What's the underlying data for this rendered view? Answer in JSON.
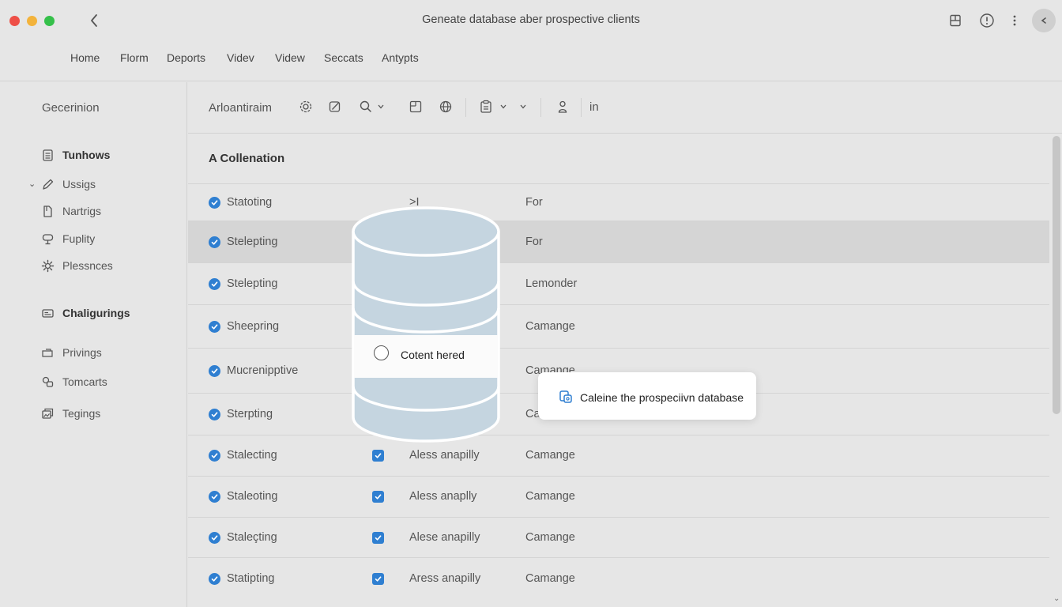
{
  "window": {
    "title": "Geneate database aber prospective clients"
  },
  "menu": [
    "Home",
    "Florm",
    "Deports",
    "Videv",
    "Videw",
    "Seccats",
    "Antypts"
  ],
  "sidebar": {
    "heading": "Gecerinion",
    "items": [
      {
        "label": "Tunhows",
        "icon": "document-icon",
        "bold": true
      },
      {
        "label": "Ussigs",
        "icon": "pencil-icon",
        "expand": true
      },
      {
        "label": "Nartrigs",
        "icon": "file-icon"
      },
      {
        "label": "Fuplity",
        "icon": "stamp-icon"
      },
      {
        "label": "Plessnces",
        "icon": "gear-icon"
      },
      {
        "label": "Chaligurings",
        "icon": "card-icon",
        "bold": true
      },
      {
        "label": "Privings",
        "icon": "tag-icon"
      },
      {
        "label": "Tomcarts",
        "icon": "link-icon"
      },
      {
        "label": "Tegings",
        "icon": "image-icon"
      }
    ]
  },
  "toolbar": {
    "title": "Arloantiraim",
    "trailing_text": "in"
  },
  "section": {
    "title": "A Collenation"
  },
  "rows": [
    {
      "col1": "Statoting",
      "checked2": false,
      "col2": ">I",
      "col3": "For"
    },
    {
      "col1": "Stelepting",
      "checked2": false,
      "col2": "",
      "col3": "For",
      "selected": true
    },
    {
      "col1": "Stelepting",
      "checked2": false,
      "col2": "",
      "col3": "Lemonder"
    },
    {
      "col1": "Sheepring",
      "checked2": false,
      "col2": "",
      "col3": "Camange"
    },
    {
      "col1": "Mucrenipptive",
      "checked2": false,
      "col2": "",
      "col3": "Camange"
    },
    {
      "col1": "Sterpting",
      "checked2": false,
      "col2": "",
      "col3": "Ca"
    },
    {
      "col1": "Stalecting",
      "checked2": true,
      "col2": "Aless anapilly",
      "col3": "Camange"
    },
    {
      "col1": "Staleoting",
      "checked2": true,
      "col2": "Aless anaplly",
      "col3": "Camange"
    },
    {
      "col1": "Staleçting",
      "checked2": true,
      "col2": "Alese anapilly",
      "col3": "Camange"
    },
    {
      "col1": "Statipting",
      "checked2": true,
      "col2": "Aress anapilly",
      "col3": "Camange"
    }
  ],
  "database_overlay": {
    "label": "Cotent hered"
  },
  "tooltip": {
    "text": "Caleine the prospeciivn database"
  },
  "colors": {
    "accent": "#2f7fd1",
    "db_fill": "#c5d5e0",
    "close": "#ee4f47",
    "minimize": "#f3b33b",
    "zoom": "#35c04a"
  }
}
